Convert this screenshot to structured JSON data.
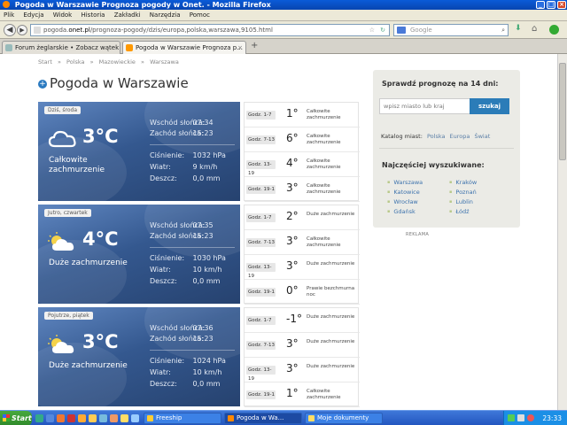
{
  "window": {
    "title": "Pogoda w Warszawie Prognoza pogody w Onet. - Mozilla Firefox"
  },
  "menu": [
    "Plik",
    "Edycja",
    "Widok",
    "Historia",
    "Zakładki",
    "Narzędzia",
    "Pomoc"
  ],
  "navbar": {
    "url_plain": "pogoda.",
    "url_host": "onet.pl",
    "url_rest": "/prognoza-pogody/dzis/europa,polska,warszawa,9105.html",
    "search_placeholder": "Google"
  },
  "tabs": [
    {
      "label": "Forum żeglarskie • Zobacz wątek ..."
    },
    {
      "label": "Pogoda w Warszawie Prognoza p..."
    }
  ],
  "breadcrumb": [
    "Start",
    "»",
    "Polska",
    "»",
    "Mazowieckie",
    "»",
    "Warszawa"
  ],
  "page_title": "Pogoda w Warszawie",
  "labels": {
    "sunrise": "Wschód słońca:",
    "sunset": "Zachód słońca:",
    "pressure": "Ciśnienie:",
    "wind": "Wiatr:",
    "rain": "Deszcz:"
  },
  "days": [
    {
      "label": "Dziś, środa",
      "temp": "3°C",
      "condition": "Całkowite zachmurzenie",
      "icon": "cloud-icon",
      "sunrise": "07:34",
      "sunset": "15:23",
      "pressure": "1032 hPa",
      "wind": "9 km/h",
      "rain": "0,0 mm",
      "periods": [
        {
          "time": "Godz. 1-7",
          "temp": "1°",
          "desc": "Całkowite zachmurzenie"
        },
        {
          "time": "Godz. 7-13",
          "temp": "6°",
          "desc": "Całkowite zachmurzenie"
        },
        {
          "time": "Godz. 13-19",
          "temp": "4°",
          "desc": "Całkowite zachmurzenie"
        },
        {
          "time": "Godz. 19-1",
          "temp": "3°",
          "desc": "Całkowite zachmurzenie"
        }
      ]
    },
    {
      "label": "Jutro, czwartek",
      "temp": "4°C",
      "condition": "Duże zachmurzenie",
      "icon": "partly-cloudy-icon",
      "sunrise": "07:35",
      "sunset": "15:23",
      "pressure": "1030 hPa",
      "wind": "10 km/h",
      "rain": "0,0 mm",
      "periods": [
        {
          "time": "Godz. 1-7",
          "temp": "2°",
          "desc": "Duże zachmurzenie"
        },
        {
          "time": "Godz. 7-13",
          "temp": "3°",
          "desc": "Całkowite zachmurzenie"
        },
        {
          "time": "Godz. 13-19",
          "temp": "3°",
          "desc": "Duże zachmurzenie"
        },
        {
          "time": "Godz. 19-1",
          "temp": "0°",
          "desc": "Prawie bezchmurna noc"
        }
      ]
    },
    {
      "label": "Pojutrze, piątek",
      "temp": "3°C",
      "condition": "Duże zachmurzenie",
      "icon": "partly-cloudy-icon",
      "sunrise": "07:36",
      "sunset": "15:23",
      "pressure": "1024 hPa",
      "wind": "10 km/h",
      "rain": "0,0 mm",
      "periods": [
        {
          "time": "Godz. 1-7",
          "temp": "-1°",
          "desc": "Duże zachmurzenie"
        },
        {
          "time": "Godz. 7-13",
          "temp": "3°",
          "desc": "Duże zachmurzenie"
        },
        {
          "time": "Godz. 13-19",
          "temp": "3°",
          "desc": "Duże zachmurzenie"
        },
        {
          "time": "Godz. 19-1",
          "temp": "1°",
          "desc": "Całkowite zachmurzenie"
        }
      ]
    }
  ],
  "sidebar": {
    "forecast_title": "Sprawdź prognozę na 14 dni:",
    "input_placeholder": "wpisz miasto lub kraj",
    "search_button": "szukaj",
    "catalog_label": "Katalog miast:",
    "catalog_links": [
      "Polska",
      "Europa",
      "Świat"
    ],
    "popular_title": "Najczęściej wyszukiwane:",
    "popular_left": [
      "Warszawa",
      "Katowice",
      "Wrocław",
      "Gdańsk"
    ],
    "popular_right": [
      "Kraków",
      "Poznań",
      "Lublin",
      "Łódź"
    ]
  },
  "ad_label": "REKLAMA",
  "taskbar": {
    "start": "Start",
    "tasks": [
      "Freeship",
      "Pogoda w Wa...",
      "Moje dokumenty"
    ],
    "clock": "23:33"
  },
  "colors": {
    "titlebar": "#0a5bd8",
    "taskbar": "#2356c0",
    "link": "#3c72ad",
    "search_button": "#2b7cb8",
    "card_top": "#5f86c0",
    "card_bottom": "#26426f"
  }
}
